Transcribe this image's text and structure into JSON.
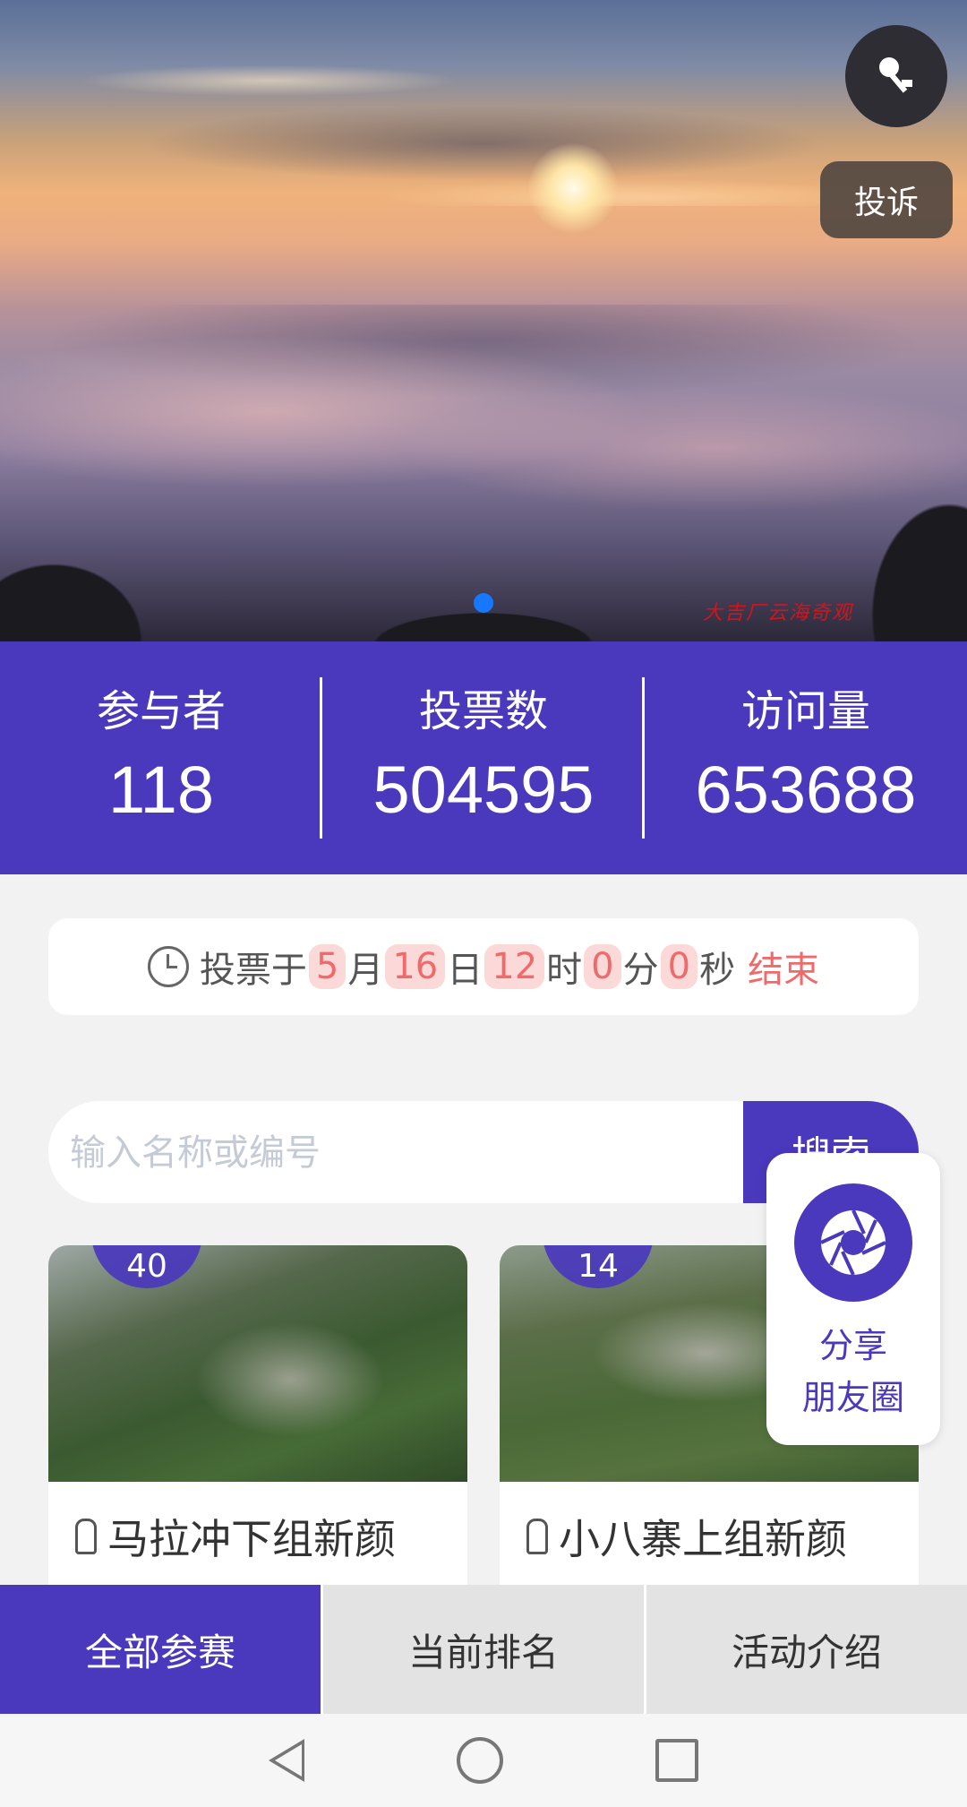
{
  "banner": {
    "watermark": "大吉厂云海奇观",
    "complain_label": "投诉",
    "music_icon": "music-note-icon"
  },
  "stats": [
    {
      "label": "参与者",
      "value": "118"
    },
    {
      "label": "投票数",
      "value": "504595"
    },
    {
      "label": "访问量",
      "value": "653688"
    }
  ],
  "countdown": {
    "prefix": "投票于",
    "month": "5",
    "month_unit": "月",
    "day": "16",
    "day_unit": "日",
    "hour": "12",
    "hour_unit": "时",
    "minute": "0",
    "minute_unit": "分",
    "second": "0",
    "second_unit": "秒",
    "suffix": "结束"
  },
  "search": {
    "placeholder": "输入名称或编号",
    "button_label": "搜索"
  },
  "share": {
    "line1": "分享",
    "line2": "朋友圈"
  },
  "cards": [
    {
      "number": "40",
      "title": "马拉冲下组新颜"
    },
    {
      "number": "14",
      "title": "小八寨上组新颜"
    }
  ],
  "tabs": [
    {
      "label": "全部参赛",
      "active": true
    },
    {
      "label": "当前排名",
      "active": false
    },
    {
      "label": "活动介绍",
      "active": false
    }
  ],
  "colors": {
    "brand": "#4a38bd",
    "accent_red": "#ef6b6b"
  }
}
